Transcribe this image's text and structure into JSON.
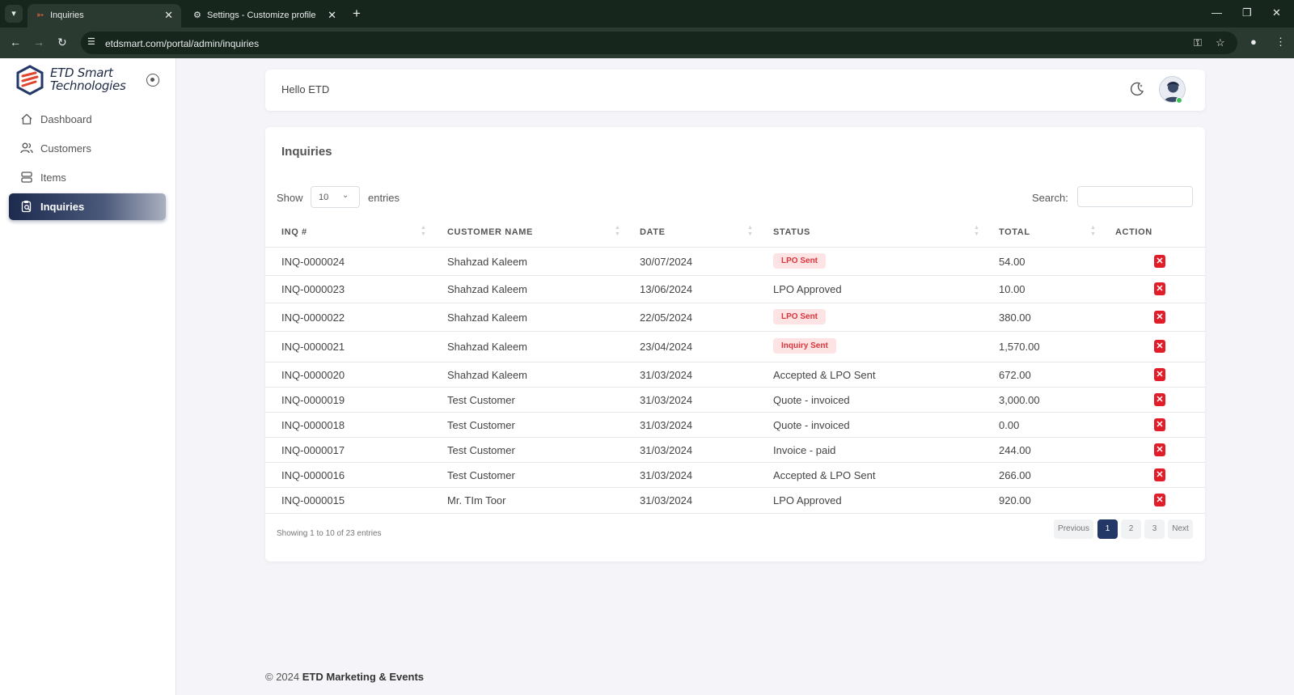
{
  "browser": {
    "tabs": [
      {
        "title": "Inquiries",
        "active": true
      },
      {
        "title": "Settings - Customize profile",
        "active": false
      }
    ],
    "url": "etdsmart.com/portal/admin/inquiries"
  },
  "brand": {
    "line1": "ETD Smart",
    "line2": "Technologies"
  },
  "sidebar": {
    "items": [
      {
        "label": "Dashboard",
        "icon": "home-icon"
      },
      {
        "label": "Customers",
        "icon": "users-icon"
      },
      {
        "label": "Items",
        "icon": "server-icon"
      },
      {
        "label": "Inquiries",
        "icon": "clipboard-search-icon",
        "active": true
      }
    ]
  },
  "header": {
    "greeting": "Hello ETD"
  },
  "inquiries": {
    "title": "Inquiries",
    "show_label": "Show",
    "entries_value": "10",
    "entries_label": "entries",
    "search_label": "Search:",
    "search_value": "",
    "columns": [
      "INQ #",
      "CUSTOMER NAME",
      "DATE",
      "STATUS",
      "TOTAL",
      "ACTION"
    ],
    "rows": [
      {
        "inq": "INQ-0000024",
        "customer": "Shahzad Kaleem",
        "date": "30/07/2024",
        "status": "LPO Sent",
        "badge": true,
        "total": "54.00"
      },
      {
        "inq": "INQ-0000023",
        "customer": "Shahzad Kaleem",
        "date": "13/06/2024",
        "status": "LPO Approved",
        "badge": false,
        "total": "10.00"
      },
      {
        "inq": "INQ-0000022",
        "customer": "Shahzad Kaleem",
        "date": "22/05/2024",
        "status": "LPO Sent",
        "badge": true,
        "total": "380.00"
      },
      {
        "inq": "INQ-0000021",
        "customer": "Shahzad Kaleem",
        "date": "23/04/2024",
        "status": "Inquiry Sent",
        "badge": true,
        "total": "1,570.00"
      },
      {
        "inq": "INQ-0000020",
        "customer": "Shahzad Kaleem",
        "date": "31/03/2024",
        "status": "Accepted & LPO Sent",
        "badge": false,
        "total": "672.00"
      },
      {
        "inq": "INQ-0000019",
        "customer": "Test Customer",
        "date": "31/03/2024",
        "status": "Quote - invoiced",
        "badge": false,
        "total": "3,000.00"
      },
      {
        "inq": "INQ-0000018",
        "customer": "Test Customer",
        "date": "31/03/2024",
        "status": "Quote - invoiced",
        "badge": false,
        "total": "0.00"
      },
      {
        "inq": "INQ-0000017",
        "customer": "Test Customer",
        "date": "31/03/2024",
        "status": "Invoice - paid",
        "badge": false,
        "total": "244.00"
      },
      {
        "inq": "INQ-0000016",
        "customer": "Test Customer",
        "date": "31/03/2024",
        "status": "Accepted & LPO Sent",
        "badge": false,
        "total": "266.00"
      },
      {
        "inq": "INQ-0000015",
        "customer": "Mr. TIm Toor",
        "date": "31/03/2024",
        "status": "LPO Approved",
        "badge": false,
        "total": "920.00"
      }
    ],
    "showing_text": "Showing 1 to 10 of 23 entries",
    "pagination": {
      "previous": "Previous",
      "pages": [
        "1",
        "2",
        "3"
      ],
      "current": "1",
      "next": "Next"
    }
  },
  "footer": {
    "prefix": "© 2024",
    "company": "ETD Marketing & Events"
  },
  "colors": {
    "accent": "#233866",
    "danger": "#e11d2a",
    "badge_bg": "#fde3e3",
    "badge_text": "#d9363e"
  }
}
